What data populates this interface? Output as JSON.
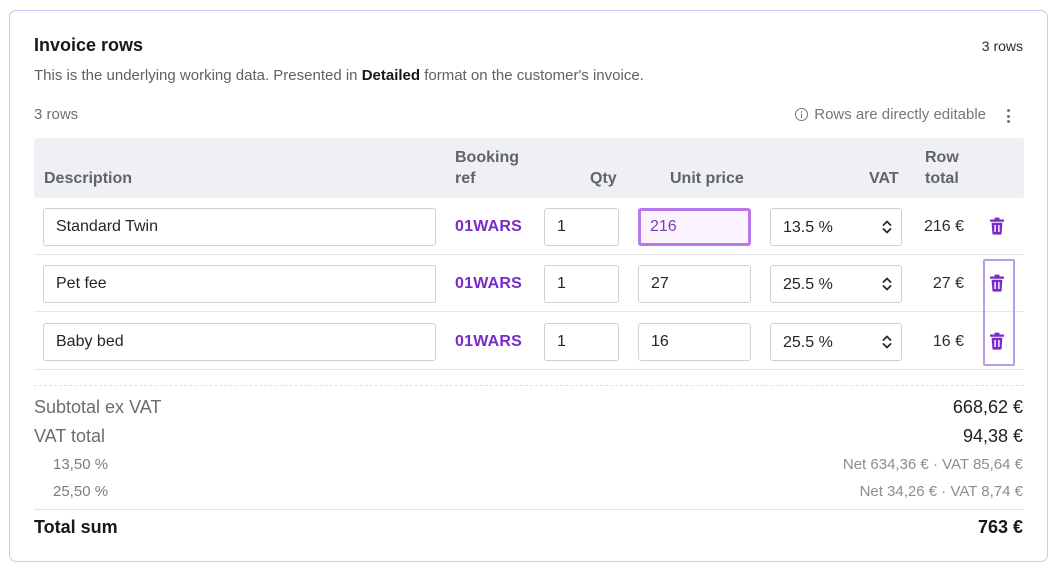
{
  "panel": {
    "title": "Invoice rows",
    "row_count_badge": "3 rows",
    "subtitle_before": "This is the underlying working data. Presented in ",
    "subtitle_format": "Detailed",
    "subtitle_after": " format on the customer's invoice."
  },
  "toolbar": {
    "rows_count": "3 rows",
    "editable_hint": "Rows are directly editable",
    "info_icon": "info-icon",
    "menu_icon": "kebab-menu-icon"
  },
  "table": {
    "headers": {
      "description": "Description",
      "booking_ref_line1": "Booking",
      "booking_ref_line2": "ref",
      "qty": "Qty",
      "unit_price": "Unit price",
      "vat": "VAT",
      "row_total_line1": "Row",
      "row_total_line2": "total"
    },
    "rows": [
      {
        "description": "Standard Twin",
        "booking_ref": "01WARS",
        "qty": "1",
        "unit_price": "216",
        "vat": "13.5 %",
        "row_total": "216 €"
      },
      {
        "description": "Pet fee",
        "booking_ref": "01WARS",
        "qty": "1",
        "unit_price": "27",
        "vat": "25.5 %",
        "row_total": "27 €"
      },
      {
        "description": "Baby bed",
        "booking_ref": "01WARS",
        "qty": "1",
        "unit_price": "16",
        "vat": "25.5 %",
        "row_total": "16 €"
      }
    ],
    "focused_field": "rows.0.unit_price"
  },
  "summary": {
    "subtotal_label": "Subtotal ex VAT",
    "subtotal_value": "668,62 €",
    "vat_total_label": "VAT total",
    "vat_total_value": "94,38 €",
    "vat_lines": [
      {
        "rate": "13,50 %",
        "detail": "Net 634,36 € · VAT 85,64 €"
      },
      {
        "rate": "25,50 %",
        "detail": "Net 34,26 € · VAT 8,74 €"
      }
    ],
    "total_label": "Total sum",
    "total_value": "763 €"
  },
  "colors": {
    "accent": "#7a2bc6",
    "focus_border": "#b878ea",
    "card_border": "#d6c2f2",
    "header_bg": "#eef0f3"
  }
}
